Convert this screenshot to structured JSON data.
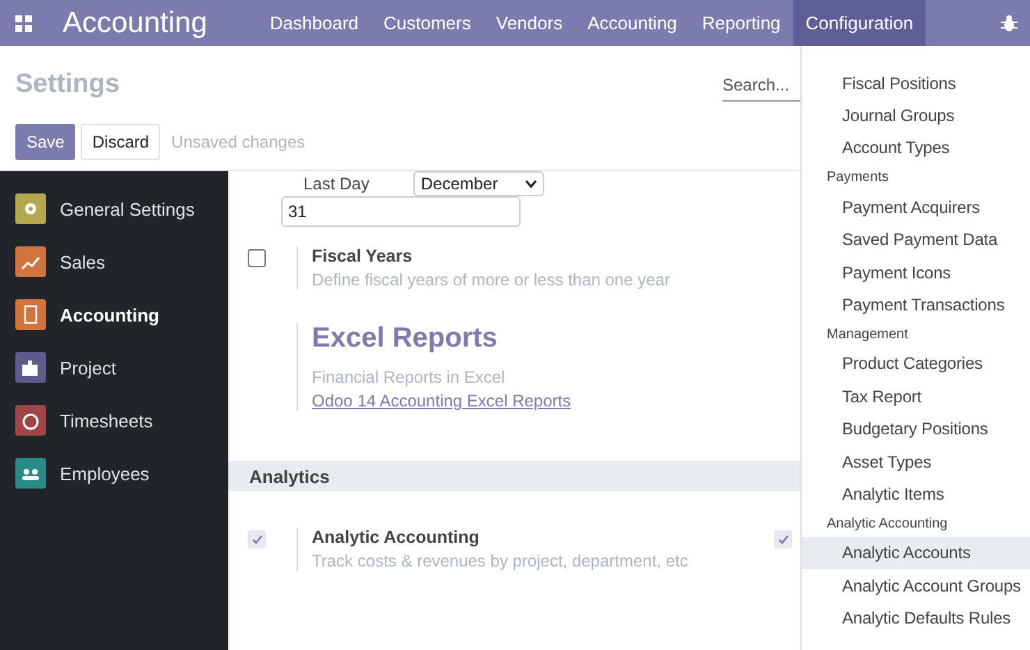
{
  "navbar": {
    "app_title": "Accounting",
    "menus": [
      {
        "label": "Dashboard",
        "selected": false
      },
      {
        "label": "Customers",
        "selected": false
      },
      {
        "label": "Vendors",
        "selected": false
      },
      {
        "label": "Accounting",
        "selected": false
      },
      {
        "label": "Reporting",
        "selected": false
      },
      {
        "label": "Configuration",
        "selected": true
      }
    ]
  },
  "control_panel": {
    "title": "Settings",
    "search": {
      "placeholder": "Search..."
    },
    "buttons": [
      "Save",
      "Discard"
    ],
    "status": "Unsaved changes"
  },
  "sidebar": {
    "items": [
      {
        "label": "General Settings",
        "kind": "gear",
        "color": "#b5a84c",
        "selected": false
      },
      {
        "label": "Sales",
        "kind": "chart",
        "color": "#d1743f",
        "selected": false
      },
      {
        "label": "Accounting",
        "kind": "invoice",
        "color": "#d1743f",
        "selected": true
      },
      {
        "label": "Project",
        "kind": "puzzle",
        "color": "#5e5c8e",
        "selected": false
      },
      {
        "label": "Timesheets",
        "kind": "stopwatch",
        "color": "#a04646",
        "selected": false
      },
      {
        "label": "Employees",
        "kind": "people",
        "color": "#2a8a85",
        "selected": false
      }
    ]
  },
  "content": {
    "last_day": {
      "label": "Last Day",
      "month": "December",
      "day": "31"
    },
    "fiscal_years": {
      "title": "Fiscal Years",
      "description": "Define fiscal years of more or less than one year",
      "checked": false
    },
    "excel_reports": {
      "heading": "Excel Reports",
      "description": "Financial Reports in Excel",
      "link": "Odoo 14 Accounting Excel Reports"
    },
    "section": "Analytics",
    "analytic_accounting": {
      "title": "Analytic Accounting",
      "description": "Track costs & revenues by project, department, etc",
      "checked": true,
      "right_checked": true
    }
  },
  "dropdown": {
    "items": [
      {
        "kind": "item",
        "label": "Fiscal Positions",
        "selected": false
      },
      {
        "kind": "item",
        "label": "Journal Groups",
        "selected": false
      },
      {
        "kind": "item",
        "label": "Account Types",
        "selected": false
      },
      {
        "kind": "header",
        "label": "Payments"
      },
      {
        "kind": "item",
        "label": "Payment Acquirers",
        "selected": false
      },
      {
        "kind": "item",
        "label": "Saved Payment Data",
        "selected": false
      },
      {
        "kind": "item",
        "label": "Payment Icons",
        "selected": false
      },
      {
        "kind": "item",
        "label": "Payment Transactions",
        "selected": false
      },
      {
        "kind": "header",
        "label": "Management"
      },
      {
        "kind": "item",
        "label": "Product Categories",
        "selected": false
      },
      {
        "kind": "item",
        "label": "Tax Report",
        "selected": false
      },
      {
        "kind": "item",
        "label": "Budgetary Positions",
        "selected": false
      },
      {
        "kind": "item",
        "label": "Asset Types",
        "selected": false
      },
      {
        "kind": "item",
        "label": "Analytic Items",
        "selected": false
      },
      {
        "kind": "header",
        "label": "Analytic Accounting"
      },
      {
        "kind": "item",
        "label": "Analytic Accounts",
        "selected": true
      },
      {
        "kind": "item",
        "label": "Analytic Account Groups",
        "selected": false
      },
      {
        "kind": "item",
        "label": "Analytic Defaults Rules",
        "selected": false
      }
    ]
  }
}
